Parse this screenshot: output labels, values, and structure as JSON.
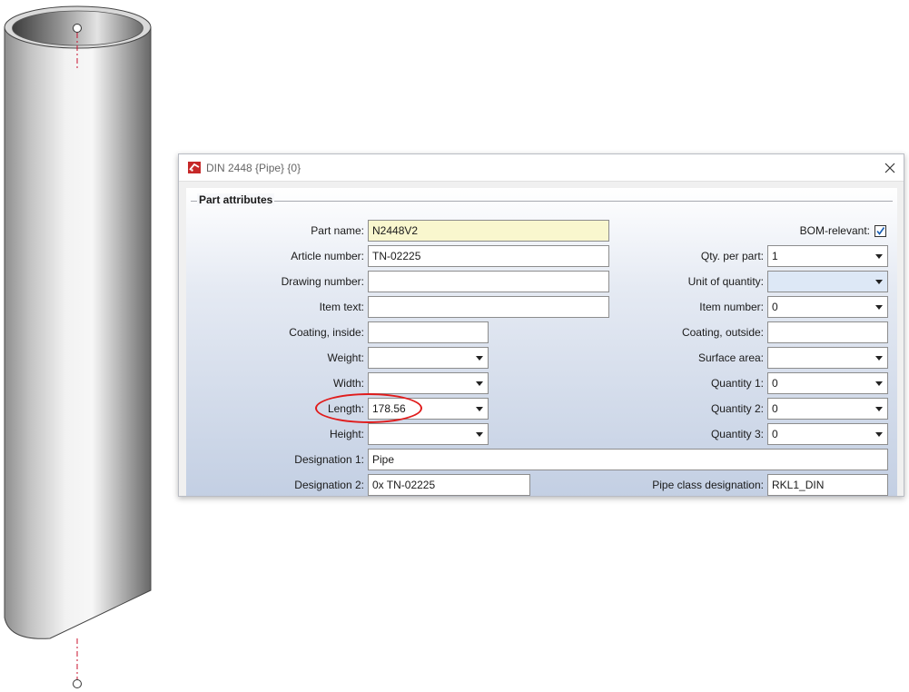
{
  "window": {
    "title": "DIN 2448 {Pipe} {0}"
  },
  "group": {
    "title": "Part attributes"
  },
  "fields": {
    "part_name": {
      "label": "Part name:",
      "value": "N2448V2"
    },
    "article_number": {
      "label": "Article number:",
      "value": "TN-02225"
    },
    "drawing_number": {
      "label": "Drawing number:",
      "value": ""
    },
    "item_text": {
      "label": "Item text:",
      "value": ""
    },
    "coating_inside": {
      "label": "Coating, inside:",
      "value": ""
    },
    "weight": {
      "label": "Weight:",
      "value": ""
    },
    "width": {
      "label": "Width:",
      "value": ""
    },
    "length": {
      "label": "Length:",
      "value": "178.56"
    },
    "height": {
      "label": "Height:",
      "value": ""
    },
    "designation_1": {
      "label": "Designation 1:",
      "value": "Pipe"
    },
    "designation_2": {
      "label": "Designation 2:",
      "value": "0x TN-02225"
    },
    "bom_relevant": {
      "label": "BOM-relevant:",
      "checked": true
    },
    "qty_per_part": {
      "label": "Qty. per part:",
      "value": "1"
    },
    "unit_of_quantity": {
      "label": "Unit of quantity:",
      "value": ""
    },
    "item_number": {
      "label": "Item number:",
      "value": "0"
    },
    "coating_outside": {
      "label": "Coating, outside:",
      "value": ""
    },
    "surface_area": {
      "label": "Surface area:",
      "value": ""
    },
    "quantity_1": {
      "label": "Quantity 1:",
      "value": "0"
    },
    "quantity_2": {
      "label": "Quantity 2:",
      "value": "0"
    },
    "quantity_3": {
      "label": "Quantity 3:",
      "value": "0"
    },
    "pipe_class": {
      "label": "Pipe class designation:",
      "value": "RKL1_DIN"
    }
  },
  "icons": {
    "app": "app-logo-icon",
    "close": "close-icon",
    "dropdown": "chevron-down-icon",
    "check": "checkmark-icon"
  },
  "colors": {
    "highlight": "#e01c1c",
    "part_name_bg": "#f9f7ce",
    "unit_field_bg": "#dde8f6",
    "axis_line": "#c8102e"
  }
}
